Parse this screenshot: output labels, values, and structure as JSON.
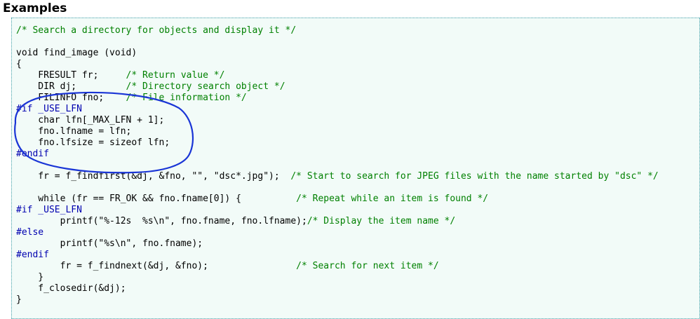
{
  "heading": "Examples",
  "code_lines": [
    [
      {
        "t": "/* Search a directory for objects and display it */",
        "c": "cm"
      }
    ],
    [
      {
        "t": "",
        "c": ""
      }
    ],
    [
      {
        "t": "void find_image (void)",
        "c": ""
      }
    ],
    [
      {
        "t": "{",
        "c": ""
      }
    ],
    [
      {
        "t": "    FRESULT fr;     ",
        "c": ""
      },
      {
        "t": "/* Return value */",
        "c": "cm"
      }
    ],
    [
      {
        "t": "    DIR dj;         ",
        "c": ""
      },
      {
        "t": "/* Directory search object */",
        "c": "cm"
      }
    ],
    [
      {
        "t": "    FILINFO fno;    ",
        "c": ""
      },
      {
        "t": "/* File information */",
        "c": "cm"
      }
    ],
    [
      {
        "t": "#if _USE_LFN",
        "c": "pp"
      }
    ],
    [
      {
        "t": "    char lfn[_MAX_LFN + 1];",
        "c": ""
      }
    ],
    [
      {
        "t": "    fno.lfname = lfn;",
        "c": ""
      }
    ],
    [
      {
        "t": "    fno.lfsize = sizeof lfn;",
        "c": ""
      }
    ],
    [
      {
        "t": "#endif",
        "c": "pp"
      }
    ],
    [
      {
        "t": "",
        "c": ""
      }
    ],
    [
      {
        "t": "    fr = f_findfirst(&dj, &fno, \"\", \"dsc*.jpg\");  ",
        "c": ""
      },
      {
        "t": "/* Start to search for JPEG files with the name started by \"dsc\" */",
        "c": "cm"
      }
    ],
    [
      {
        "t": "",
        "c": ""
      }
    ],
    [
      {
        "t": "    while (fr == FR_OK && fno.fname[0]) {          ",
        "c": ""
      },
      {
        "t": "/* Repeat while an item is found */",
        "c": "cm"
      }
    ],
    [
      {
        "t": "#if _USE_LFN",
        "c": "pp"
      }
    ],
    [
      {
        "t": "        printf(\"%-12s  %s\\n\", fno.fname, fno.lfname);",
        "c": ""
      },
      {
        "t": "/* Display the item name */",
        "c": "cm"
      }
    ],
    [
      {
        "t": "#else",
        "c": "pp"
      }
    ],
    [
      {
        "t": "        printf(\"%s\\n\", fno.fname);",
        "c": ""
      }
    ],
    [
      {
        "t": "#endif",
        "c": "pp"
      }
    ],
    [
      {
        "t": "        fr = f_findnext(&dj, &fno);                ",
        "c": ""
      },
      {
        "t": "/* Search for next item */",
        "c": "cm"
      }
    ],
    [
      {
        "t": "    }",
        "c": ""
      }
    ],
    [
      {
        "t": "    f_closedir(&dj);",
        "c": ""
      }
    ],
    [
      {
        "t": "}",
        "c": ""
      }
    ]
  ],
  "colors": {
    "comment": "#008000",
    "preprocessor": "#0000b0",
    "code_background": "#f2fbf8",
    "code_border": "#3f9fa8",
    "annotation": "#1a35d6"
  }
}
